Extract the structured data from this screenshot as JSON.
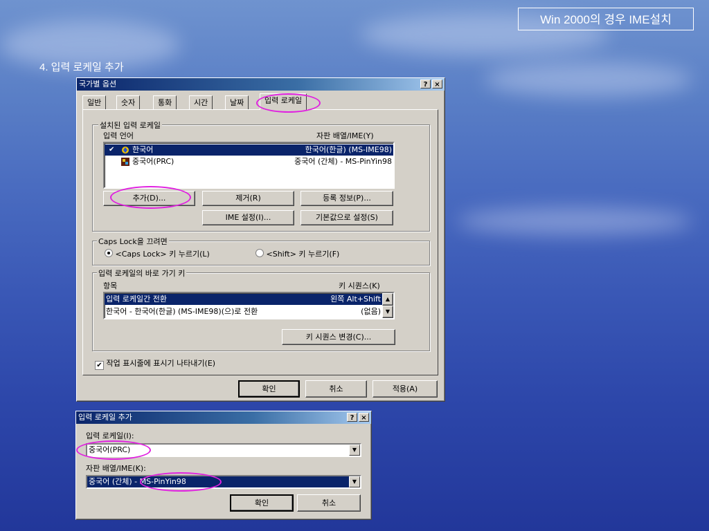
{
  "slide": {
    "title": "Win 2000의 경우 IME설치",
    "step": "4. 입력 로케일 추가"
  },
  "main_dialog": {
    "title": "국가별 옵션",
    "help_btn": "?",
    "close_btn": "×",
    "tabs": [
      "일반",
      "숫자",
      "통화",
      "시간",
      "날짜",
      "입력 로케일"
    ],
    "installed_group": {
      "label": "설치된 입력 로케일",
      "col_language": "입력 언어",
      "col_layout": "자판 배열/IME(Y)",
      "items": [
        {
          "lang": "한국어",
          "layout": "한국어(한글) (MS-IME98)",
          "selected": true,
          "check": "✔"
        },
        {
          "lang": "중국어(PRC)",
          "layout": "중국어 (간체) - MS-PinYin98",
          "selected": false
        }
      ],
      "buttons": {
        "add": "추가(D)...",
        "remove": "제거(R)",
        "properties": "등록 정보(P)...",
        "ime_settings": "IME 설정(I)...",
        "set_default": "기본값으로 설정(S)"
      }
    },
    "capslock_group": {
      "label": "Caps Lock을 끄려면",
      "option1": "<Caps Lock> 키 누르기(L)",
      "option2": "<Shift> 키 누르기(F)",
      "selected": "option1"
    },
    "hotkey_group": {
      "label": "입력 로케일의 바로 가기 키",
      "col_item": "항목",
      "col_sequence": "키 시퀀스(K)",
      "rows": [
        {
          "item": "입력 로케일간 전환",
          "sequence": "왼쪽 Alt+Shift",
          "selected": true
        },
        {
          "item": "한국어 - 한국어(한글) (MS-IME98)(으)로 전환",
          "sequence": "(없음)",
          "selected": false
        }
      ],
      "change_btn": "키 시퀀스 변경(C)..."
    },
    "taskbar_check": {
      "label": "작업 표시줄에 표시기 나타내기(E)",
      "checked": true,
      "mark": "✔"
    },
    "footer": {
      "ok": "확인",
      "cancel": "취소",
      "apply": "적용(A)"
    }
  },
  "add_dialog": {
    "title": "입력 로케일 추가",
    "help_btn": "?",
    "close_btn": "×",
    "locale_label": "입력 로케일(I):",
    "locale_value": "중국어(PRC)",
    "layout_label": "자판 배열/IME(K):",
    "layout_value": "중국어 (간체) - MS-PinYin98",
    "ok": "확인",
    "cancel": "취소",
    "dropdown_arrow": "▼"
  },
  "icons": {
    "check": "check-mark-icon",
    "korean": "korean-ime-icon",
    "chinese": "chinese-ime-icon",
    "scroll_up": "▲",
    "scroll_down": "▼"
  },
  "colors": {
    "selection": "#0a246a",
    "highlight_ellipse": "#e020e0",
    "dialog_face": "#d4d0c8"
  }
}
